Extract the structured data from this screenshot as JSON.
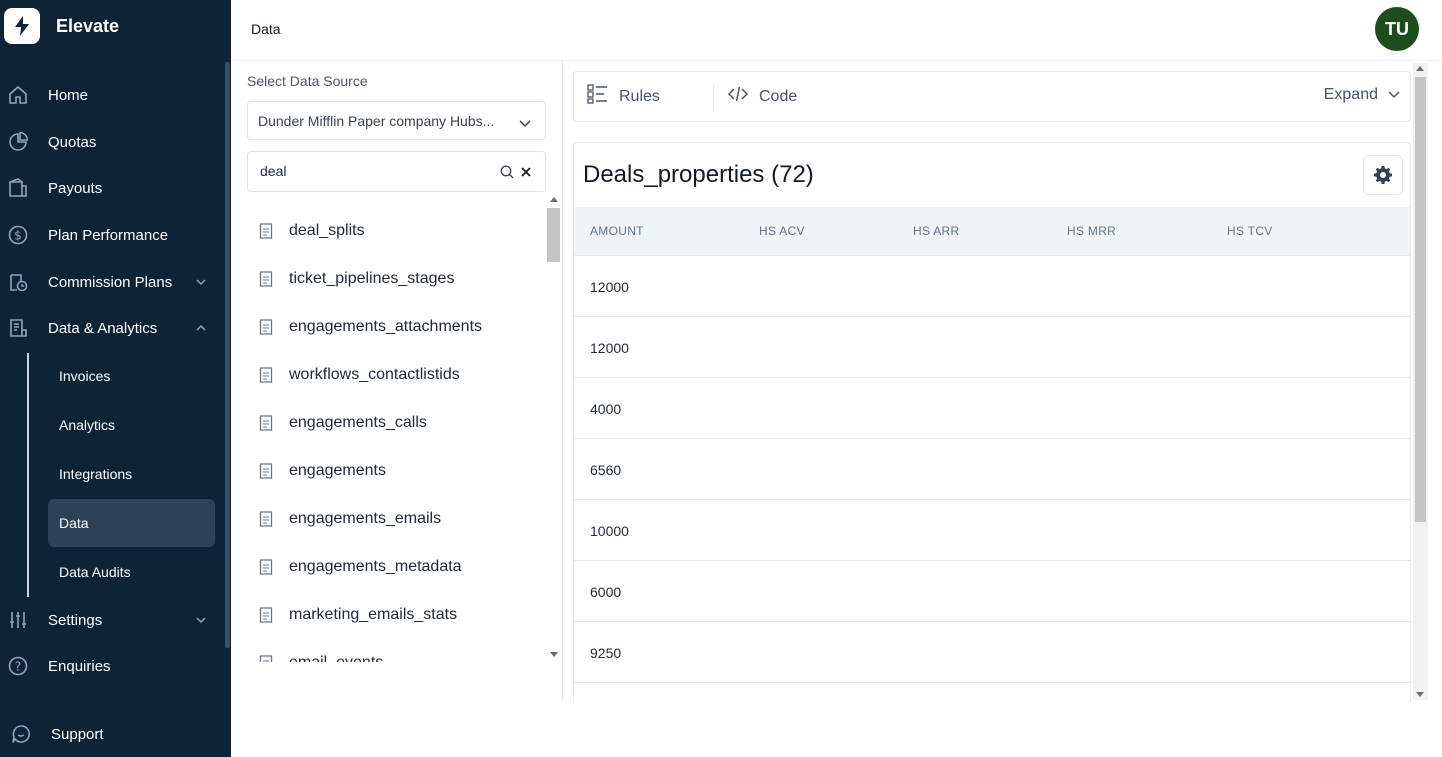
{
  "app": {
    "name": "Elevate",
    "logo_icon": "lightning-bolt-icon"
  },
  "sidebar": {
    "items": [
      {
        "label": "Home",
        "icon": "home-icon"
      },
      {
        "label": "Quotas",
        "icon": "pie-chart-icon"
      },
      {
        "label": "Payouts",
        "icon": "wallet-icon"
      },
      {
        "label": "Plan Performance",
        "icon": "dollar-circle-icon"
      },
      {
        "label": "Commission Plans",
        "icon": "clipboard-clock-icon",
        "expandable": true,
        "expanded": false
      },
      {
        "label": "Data & Analytics",
        "icon": "document-chart-icon",
        "expandable": true,
        "expanded": true
      },
      {
        "label": "Settings",
        "icon": "sliders-icon",
        "expandable": true,
        "expanded": false
      },
      {
        "label": "Enquiries",
        "icon": "question-circle-icon"
      }
    ],
    "sub_items": [
      {
        "label": "Invoices",
        "active": false
      },
      {
        "label": "Analytics",
        "active": false
      },
      {
        "label": "Integrations",
        "active": false
      },
      {
        "label": "Data",
        "active": true
      },
      {
        "label": "Data Audits",
        "active": false
      }
    ],
    "support": {
      "label": "Support",
      "icon": "chat-bubble-icon"
    }
  },
  "header": {
    "title": "Data",
    "avatar_initials": "TU"
  },
  "data_source": {
    "label": "Select Data Source",
    "selected": "Dunder Mifflin Paper company Hubs...",
    "search_value": "deal",
    "tables": [
      "deal_splits",
      "ticket_pipelines_stages",
      "engagements_attachments",
      "workflows_contactlistids",
      "engagements_calls",
      "engagements",
      "engagements_emails",
      "engagements_metadata",
      "marketing_emails_stats",
      "email_events"
    ]
  },
  "toolbar": {
    "rules_label": "Rules",
    "code_label": "Code",
    "expand_label": "Expand"
  },
  "table": {
    "title": "Deals_properties (72)",
    "columns": [
      "AMOUNT",
      "HS ACV",
      "HS ARR",
      "HS MRR",
      "HS TCV"
    ],
    "rows": [
      [
        "12000",
        "",
        "",
        "",
        ""
      ],
      [
        "12000",
        "",
        "",
        "",
        ""
      ],
      [
        "4000",
        "",
        "",
        "",
        ""
      ],
      [
        "6560",
        "",
        "",
        "",
        ""
      ],
      [
        "10000",
        "",
        "",
        "",
        ""
      ],
      [
        "6000",
        "",
        "",
        "",
        ""
      ],
      [
        "9250",
        "",
        "",
        "",
        ""
      ]
    ]
  },
  "colors": {
    "sidebar_bg": "#0f2337",
    "active_item_bg": "#2c4257",
    "avatar_bg": "#1d4d1d",
    "table_header_bg": "#f1f4f7"
  }
}
